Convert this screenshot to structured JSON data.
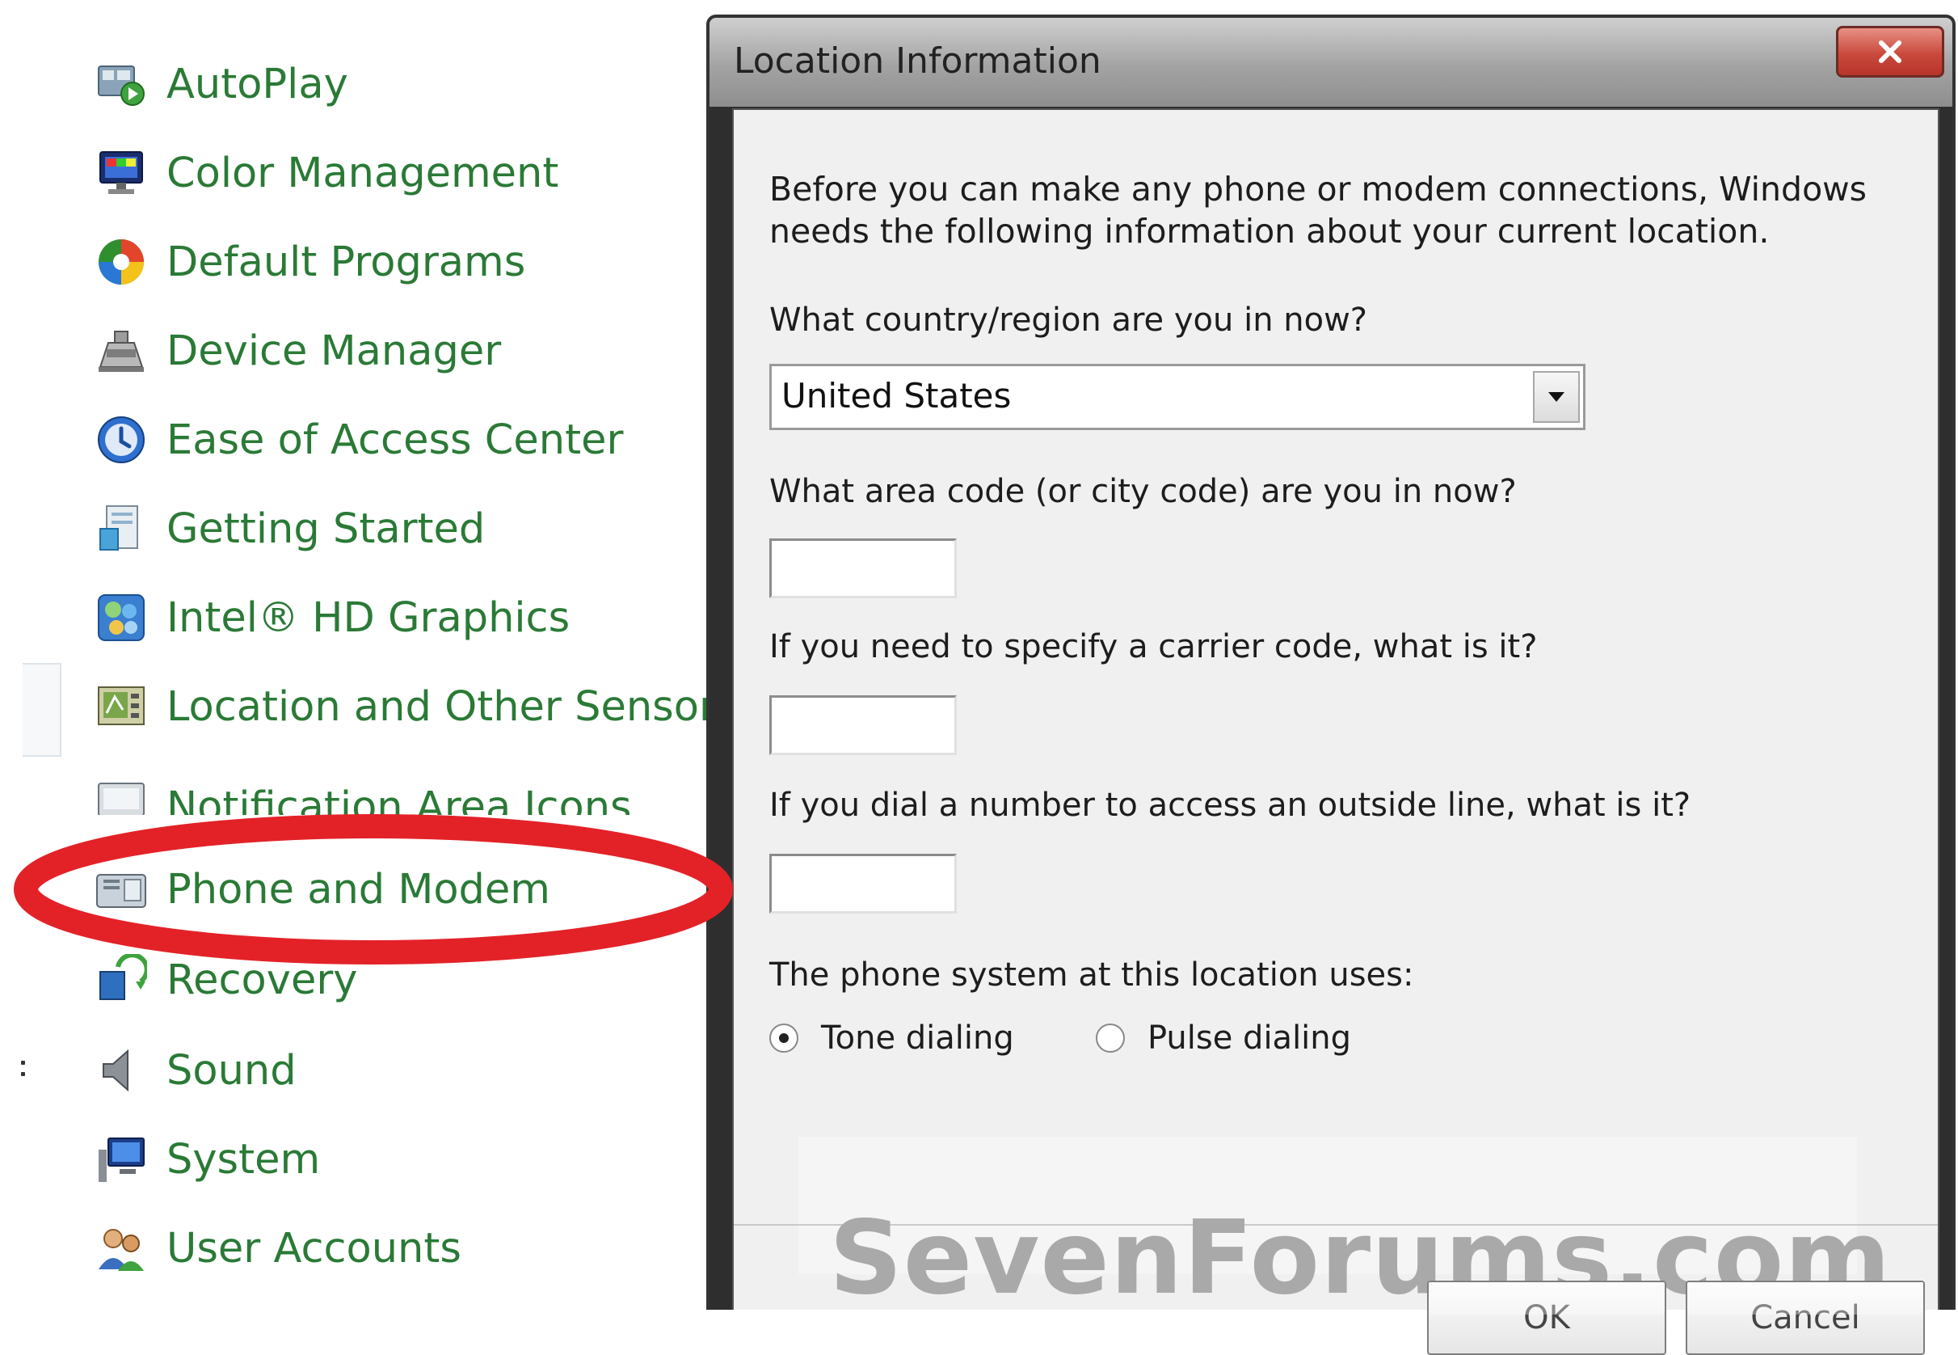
{
  "control_panel": {
    "items": [
      {
        "label": "AutoPlay",
        "icon": "autoplay-icon"
      },
      {
        "label": "Color Management",
        "icon": "color-management-icon"
      },
      {
        "label": "Default Programs",
        "icon": "default-programs-icon"
      },
      {
        "label": "Device Manager",
        "icon": "device-manager-icon"
      },
      {
        "label": "Ease of Access Center",
        "icon": "ease-of-access-icon"
      },
      {
        "label": "Getting Started",
        "icon": "getting-started-icon"
      },
      {
        "label": "Intel® HD Graphics",
        "icon": "intel-graphics-icon"
      },
      {
        "label": "Location and Other Sensors",
        "icon": "location-sensors-icon"
      },
      {
        "label": "Notification Area Icons",
        "icon": "notification-area-icon"
      },
      {
        "label": "Phone and Modem",
        "icon": "phone-modem-icon"
      },
      {
        "label": "Recovery",
        "icon": "recovery-icon"
      },
      {
        "label": "Sound",
        "icon": "speaker-icon"
      },
      {
        "label": "System",
        "icon": "system-icon"
      },
      {
        "label": "User Accounts",
        "icon": "user-accounts-icon"
      }
    ],
    "highlighted_item": "Phone and Modem",
    "highlight_color": "#e32228",
    "label_color": "#2a7a36"
  },
  "dialog": {
    "title": "Location Information",
    "close_label": "X",
    "intro": "Before you can make any phone or modem connections, Windows needs the following information about your current location.",
    "country_label": "What country/region are you in now?",
    "country_value": "United States",
    "area_code_label": "What area code (or city code) are you in now?",
    "area_code_value": "",
    "carrier_code_label": "If you need to specify a carrier code, what is it?",
    "carrier_code_value": "",
    "outside_line_label": "If you dial a number to access an outside line, what is it?",
    "outside_line_value": "",
    "phone_system_label": "The phone system at this location uses:",
    "dialing_options": [
      {
        "label": "Tone dialing",
        "checked": true
      },
      {
        "label": "Pulse dialing",
        "checked": false
      }
    ],
    "ok_label": "OK",
    "cancel_label": "Cancel"
  },
  "watermark": "SevenForums.com"
}
